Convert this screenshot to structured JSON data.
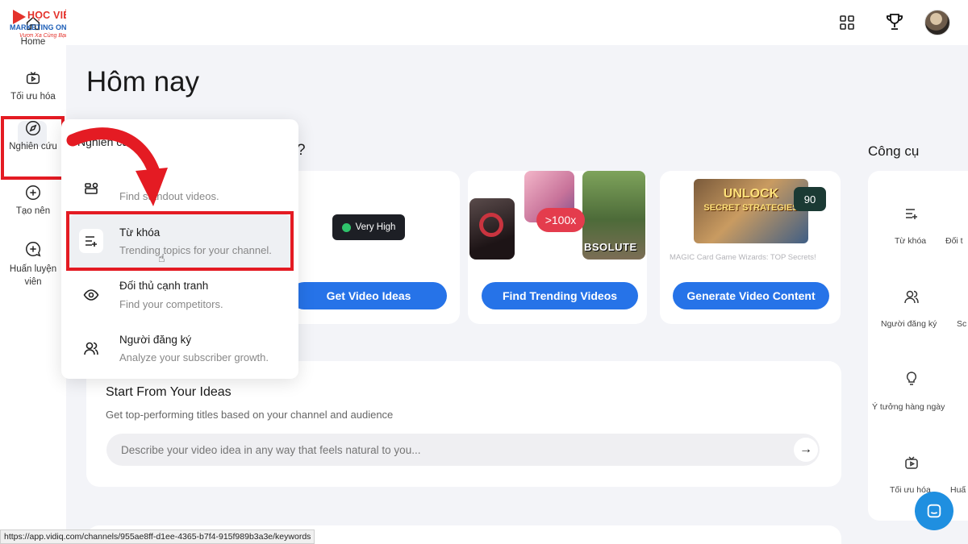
{
  "logo": {
    "line1": "HỌC VIỆN",
    "line2": "MARKETING ONLINE",
    "line3": "Vươn Xa Cùng Bạn"
  },
  "rail": {
    "home": "Home",
    "optimize": "Tối ưu hóa",
    "research": "Nghiên cứu",
    "create": "Tạo nên",
    "coach": "Huấn luyện viên"
  },
  "page": {
    "title": "Hôm nay",
    "question_mark": "?"
  },
  "cards": {
    "very_high": "Very High",
    "badge_100x": ">100x",
    "absolute_text": "BSOLUTE",
    "unlock_line1": "UNLOCK",
    "unlock_line2": "SECRET STRATEGIES",
    "score_90": "90",
    "magic_caption": "MAGIC Card Game Wizards: TOP Secrets!",
    "btn_ideas": "Get Video Ideas",
    "btn_trending": "Find Trending Videos",
    "btn_generate": "Generate Video Content"
  },
  "ideas": {
    "title": "Start From Your Ideas",
    "subtitle": "Get top-performing titles based on your channel and audience",
    "placeholder": "Describe your video idea in any way that feels natural to you...",
    "go": "→"
  },
  "tools": {
    "title": "Công cụ",
    "items": [
      "Từ khóa",
      "Đối t",
      "Người đăng ký",
      "Sc",
      "Ý tưởng hàng ngày",
      "Tối ưu hóa",
      "Huấ"
    ]
  },
  "menu": {
    "header": "Nghiên cứu",
    "items": [
      {
        "title": "",
        "sub": "Find standout videos."
      },
      {
        "title": "Từ khóa",
        "sub": "Trending topics for your channel."
      },
      {
        "title": "Đối thủ cạnh tranh",
        "sub": "Find your competitors."
      },
      {
        "title": "Người đăng ký",
        "sub": "Analyze your subscriber growth."
      }
    ]
  },
  "status_url": "https://app.vidiq.com/channels/955ae8ff-d1ee-4365-b7f4-915f989b3a3e/keywords",
  "colors": {
    "accent": "#2673e8",
    "highlight": "#e41b23",
    "chat": "#1f8fe0"
  }
}
